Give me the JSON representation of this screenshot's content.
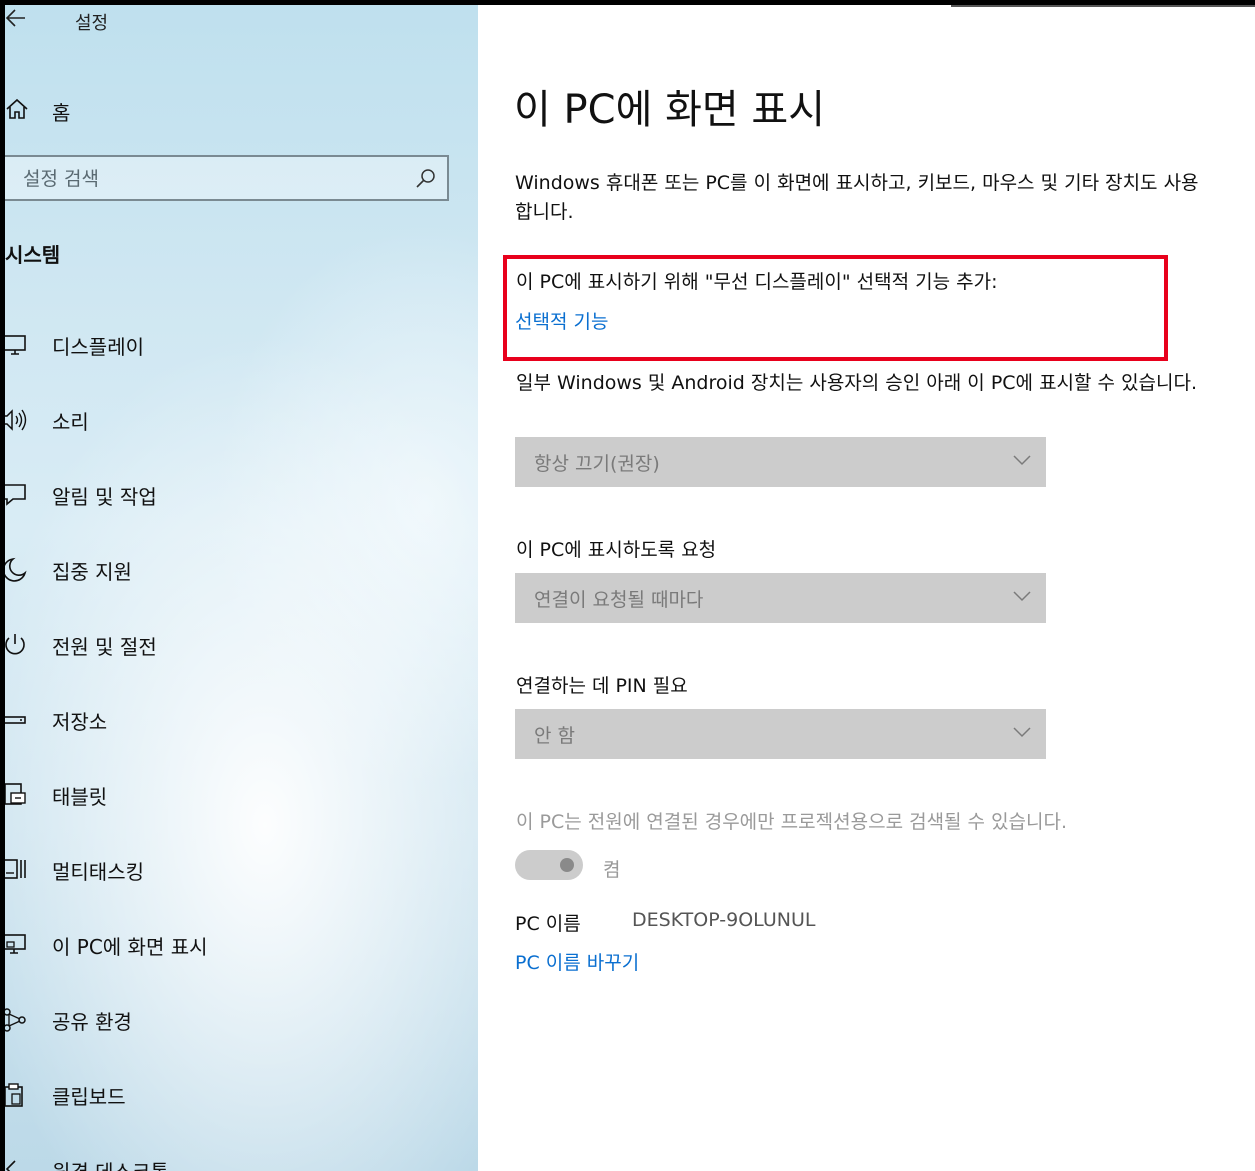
{
  "window": {
    "app_title": "설정",
    "accent_color": "#0a6fd0",
    "highlight_color": "#e8001c"
  },
  "sidebar": {
    "home_label": "홈",
    "search_placeholder": "설정 검색",
    "section_title": "시스템",
    "items": [
      {
        "label": "디스플레이",
        "icon": "monitor-icon"
      },
      {
        "label": "소리",
        "icon": "speaker-icon"
      },
      {
        "label": "알림 및 작업",
        "icon": "notification-icon"
      },
      {
        "label": "집중 지원",
        "icon": "moon-icon"
      },
      {
        "label": "전원 및 절전",
        "icon": "power-icon"
      },
      {
        "label": "저장소",
        "icon": "storage-icon"
      },
      {
        "label": "태블릿",
        "icon": "tablet-icon"
      },
      {
        "label": "멀티태스킹",
        "icon": "multitasking-icon"
      },
      {
        "label": "이 PC에 화면 표시",
        "icon": "project-icon"
      },
      {
        "label": "공유 환경",
        "icon": "share-icon"
      },
      {
        "label": "클립보드",
        "icon": "clipboard-icon"
      },
      {
        "label": "원격 데스크톱",
        "icon": "remote-desktop-icon"
      }
    ]
  },
  "main": {
    "title": "이 PC에 화면 표시",
    "description": "Windows 휴대폰 또는 PC를 이 화면에 표시하고, 키보드, 마우스 및 기타 장치도 사용합니다.",
    "optional_feature_text": "이 PC에 표시하기 위해 \"무선 디스플레이\" 선택적 기능 추가:",
    "optional_feature_link": "선택적 기능",
    "android_text": "일부 Windows 및 Android 장치는 사용자의 승인 아래 이 PC에 표시할 수 있습니다.",
    "dropdown_availability": "항상 끄기(권장)",
    "ask_label": "이 PC에 표시하도록 요청",
    "dropdown_ask": "연결이 요청될 때마다",
    "pin_label": "연결하는 데 PIN 필요",
    "dropdown_pin": "안 함",
    "projection_text": "이 PC는 전원에 연결된 경우에만 프로젝션용으로 검색될 수 있습니다.",
    "toggle_label": "켬",
    "toggle_on": true,
    "pc_name_label": "PC 이름",
    "pc_name_value": "DESKTOP-9OLUNUL",
    "rename_link": "PC 이름 바꾸기"
  }
}
